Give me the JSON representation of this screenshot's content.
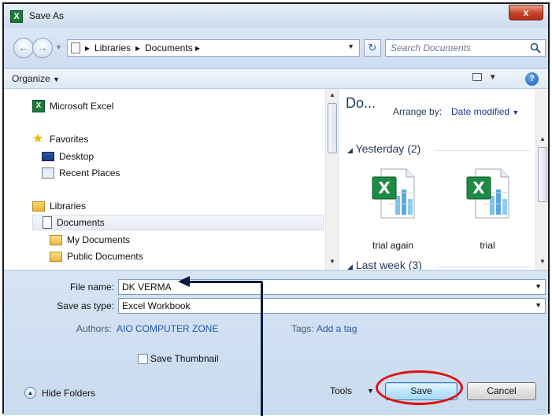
{
  "window": {
    "title": "Save As",
    "close_symbol": "x"
  },
  "address": {
    "crumbs": [
      "Libraries",
      "Documents"
    ],
    "search_placeholder": "Search Documents"
  },
  "toolbar": {
    "organize_label": "Organize"
  },
  "navigation": {
    "items": [
      {
        "label": "Microsoft Excel",
        "icon": "excel-icon"
      },
      {
        "label": "Favorites",
        "icon": "star-icon"
      },
      {
        "label": "Desktop",
        "icon": "desktop-icon"
      },
      {
        "label": "Recent Places",
        "icon": "recent-places-icon"
      },
      {
        "label": "Libraries",
        "icon": "libraries-icon"
      },
      {
        "label": "Documents",
        "icon": "documents-icon",
        "selected": true
      },
      {
        "label": "My Documents",
        "icon": "folder-icon"
      },
      {
        "label": "Public Documents",
        "icon": "folder-icon"
      }
    ]
  },
  "library": {
    "title": "Do...",
    "arrange_label": "Arrange by:",
    "arrange_value": "Date modified",
    "groups": [
      {
        "label": "Yesterday (2)"
      },
      {
        "label": "Last week (3)"
      }
    ],
    "files": [
      {
        "name": "trial again",
        "icon": "excel-file-icon"
      },
      {
        "name": "trial",
        "icon": "excel-file-icon"
      }
    ]
  },
  "form": {
    "filename_label": "File name:",
    "filename_value": "DK VERMA",
    "savetype_label": "Save as type:",
    "savetype_value": "Excel Workbook",
    "authors_label": "Authors:",
    "authors_value": "AIO COMPUTER ZONE",
    "tags_label": "Tags:",
    "tags_value": "Add a tag",
    "thumbnail_label": "Save Thumbnail",
    "thumbnail_checked": false
  },
  "footer": {
    "hide_folders_label": "Hide Folders",
    "tools_label": "Tools",
    "save_label": "Save",
    "cancel_label": "Cancel"
  },
  "colors": {
    "frame": "#cfe0f3",
    "annotation_highlight": "#e01010",
    "annotation_arrow": "#0a1a40"
  }
}
